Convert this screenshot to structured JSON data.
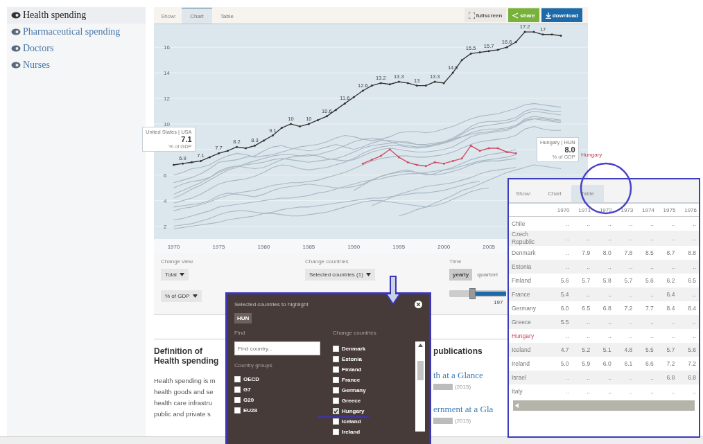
{
  "sidebar": {
    "items": [
      {
        "label": "Health spending",
        "selected": true
      },
      {
        "label": "Pharmaceutical spending",
        "selected": false
      },
      {
        "label": "Doctors",
        "selected": false
      },
      {
        "label": "Nurses",
        "selected": false
      }
    ]
  },
  "chart_panel": {
    "tabs_label": "Show:",
    "tabs": [
      {
        "label": "Chart",
        "selected": true
      },
      {
        "label": "Table",
        "selected": false
      }
    ],
    "buttons": [
      {
        "kind": "fullscreen",
        "label": "fullscreen"
      },
      {
        "kind": "share",
        "label": "share"
      },
      {
        "kind": "download",
        "label": "download"
      }
    ],
    "chart_data": {
      "type": "line",
      "xlim": [
        1967.8,
        2016
      ],
      "ylim": [
        1.0,
        17.8
      ],
      "grid": true,
      "x": [
        1970,
        1971,
        1972,
        1973,
        1974,
        1975,
        1976,
        1977,
        1978,
        1979,
        1980,
        1981,
        1982,
        1983,
        1984,
        1985,
        1986,
        1987,
        1988,
        1989,
        1990,
        1991,
        1992,
        1993,
        1994,
        1995,
        1996,
        1997,
        1998,
        1999,
        2000,
        2001,
        2002,
        2003,
        2004,
        2005,
        2006,
        2007,
        2008,
        2009,
        2010,
        2011,
        2012,
        2013
      ],
      "xticks": [
        1970,
        1975,
        1980,
        1985,
        1990,
        1995,
        2000,
        2005
      ],
      "yticks": [
        16,
        14,
        12,
        10,
        6,
        4,
        2
      ],
      "series": [
        {
          "color": "#333333",
          "values": [
            6.8,
            6.9,
            7.0,
            7.1,
            7.4,
            7.7,
            7.9,
            8.2,
            8.1,
            8.3,
            8.7,
            9.1,
            9.7,
            10,
            9.8,
            10,
            10.3,
            10.6,
            11.1,
            11.6,
            12.1,
            12.6,
            13.0,
            13.2,
            13.1,
            13.3,
            13.2,
            13.0,
            13.0,
            13.3,
            13.2,
            14.0,
            15.0,
            15.5,
            15.6,
            15.7,
            15.8,
            16.0,
            16.4,
            17.2,
            17.2,
            17.0,
            17.0,
            16.9
          ]
        },
        {
          "name": "Hungary",
          "color": "#d24c63",
          "values": [
            null,
            null,
            null,
            null,
            null,
            null,
            null,
            null,
            null,
            null,
            null,
            null,
            null,
            null,
            null,
            null,
            null,
            null,
            null,
            null,
            null,
            6.9,
            7.2,
            7.5,
            8.0,
            7.4,
            7.0,
            6.8,
            6.7,
            7.0,
            6.9,
            7.1,
            7.3,
            8.3,
            7.9,
            8.1,
            8.1,
            7.8,
            7.7,
            null,
            null,
            null,
            null,
            null
          ]
        },
        {
          "color": "#a9b7c2",
          "values": [
            3.2,
            3.4,
            3.5,
            3.7,
            3.9,
            4.2,
            4.4,
            4.6,
            4.7,
            4.8,
            5.0,
            5.2,
            5.3,
            5.4,
            5.4,
            5.5,
            5.6,
            5.8,
            6.0,
            6.2,
            6.5,
            6.8,
            7.1,
            7.3,
            7.4,
            7.5,
            7.5,
            7.4,
            7.4,
            7.5,
            7.6,
            7.8,
            8.1,
            8.4,
            8.6,
            8.7,
            8.8,
            8.9,
            9.1,
            9.6,
            9.8,
            9.6,
            9.5,
            9.5
          ]
        },
        {
          "color": "#a9b7c2",
          "values": [
            4.5,
            4.8,
            5.1,
            5.4,
            5.8,
            6.3,
            6.6,
            6.7,
            6.8,
            6.9,
            7.0,
            7.2,
            7.3,
            7.2,
            7.1,
            7.0,
            7.1,
            7.2,
            7.3,
            7.5,
            7.8,
            8.1,
            8.3,
            8.4,
            8.5,
            8.6,
            8.6,
            8.4,
            8.3,
            8.4,
            8.5,
            8.8,
            9.2,
            9.6,
            9.8,
            9.9,
            10.0,
            10.1,
            10.3,
            10.8,
            11.0,
            10.9,
            10.8,
            10.7
          ]
        },
        {
          "color": "#a9b7c2",
          "values": [
            5.0,
            5.3,
            5.5,
            5.6,
            5.8,
            6.2,
            6.5,
            6.7,
            6.6,
            6.5,
            6.6,
            6.9,
            7.2,
            7.4,
            7.5,
            7.6,
            7.5,
            7.3,
            7.2,
            7.1,
            7.2,
            7.5,
            7.8,
            8.0,
            8.1,
            8.0,
            7.9,
            7.8,
            7.8,
            7.9,
            8.0,
            8.2,
            8.6,
            9.0,
            9.2,
            9.3,
            9.4,
            9.5,
            9.8,
            10.4,
            10.6,
            10.5,
            10.4,
            10.3
          ]
        },
        {
          "color": "#a9b7c2",
          "values": [
            2.5,
            2.6,
            2.8,
            3.0,
            3.2,
            3.5,
            3.6,
            3.7,
            3.8,
            3.9,
            4.0,
            4.1,
            4.2,
            4.2,
            4.3,
            4.4,
            4.6,
            4.7,
            4.9,
            5.1,
            5.3,
            5.5,
            5.6,
            5.7,
            5.9,
            6.0,
            6.1,
            6.1,
            6.2,
            6.3,
            6.4,
            6.5,
            6.7,
            6.9,
            7.1,
            7.2,
            7.3,
            7.4,
            7.6,
            null,
            null,
            null,
            null,
            null
          ]
        },
        {
          "color": "#a9b7c2",
          "values": [
            3.8,
            4.0,
            4.2,
            4.5,
            4.9,
            5.3,
            5.5,
            5.6,
            5.7,
            5.9,
            6.2,
            6.6,
            6.8,
            6.7,
            6.5,
            6.4,
            6.5,
            6.6,
            6.8,
            7.0,
            7.3,
            7.7,
            8.0,
            8.2,
            8.3,
            8.3,
            8.2,
            8.1,
            8.2,
            8.4,
            8.6,
            8.9,
            9.3,
            9.8,
            10.1,
            10.2,
            10.2,
            10.3,
            10.5,
            11.0,
            11.2,
            11.1,
            11.0,
            11.0
          ]
        },
        {
          "color": "#a9b7c2",
          "values": [
            5.4,
            5.6,
            5.8,
            6.1,
            6.5,
            7.0,
            7.1,
            7.2,
            7.4,
            7.5,
            7.9,
            8.2,
            8.3,
            8.1,
            8.0,
            7.9,
            8.0,
            8.2,
            8.4,
            8.2,
            8.0,
            8.2,
            8.5,
            8.7,
            8.7,
            8.6,
            8.5,
            8.4,
            8.4,
            8.5,
            8.6,
            8.8,
            9.0,
            9.3,
            9.5,
            9.6,
            9.6,
            9.7,
            9.9,
            10.3,
            10.4,
            10.4,
            10.3,
            10.2
          ]
        },
        {
          "color": "#a9b7c2",
          "values": [
            1.8,
            1.9,
            2.0,
            2.1,
            2.2,
            2.3,
            2.5,
            2.6,
            2.7,
            2.8,
            3.0,
            3.1,
            3.3,
            3.4,
            3.5,
            3.5,
            3.6,
            3.7,
            3.8,
            3.9,
            4.0,
            4.1,
            4.2,
            4.2,
            4.3,
            4.4,
            4.5,
            4.6,
            4.6,
            4.7,
            4.8,
            5.0,
            5.2,
            5.4,
            5.5,
            null,
            null,
            null,
            null,
            null,
            null,
            null,
            null,
            null
          ]
        },
        {
          "color": "#a9b7c2",
          "values": [
            null,
            null,
            null,
            null,
            null,
            null,
            null,
            null,
            null,
            null,
            null,
            null,
            null,
            null,
            null,
            null,
            null,
            null,
            null,
            null,
            4.8,
            5.2,
            5.6,
            5.9,
            6.1,
            6.3,
            6.4,
            6.2,
            6.0,
            6.1,
            6.4,
            6.6,
            6.9,
            7.2,
            7.4,
            7.6,
            7.7,
            7.8,
            8.0,
            null,
            null,
            null,
            null,
            null
          ]
        },
        {
          "color": "#a9b7c2",
          "values": [
            null,
            null,
            null,
            null,
            null,
            null,
            null,
            null,
            null,
            null,
            null,
            null,
            null,
            null,
            null,
            null,
            null,
            null,
            null,
            null,
            null,
            null,
            null,
            null,
            null,
            2.8,
            3.0,
            3.3,
            3.5,
            3.8,
            4.1,
            4.4,
            4.8,
            5.0,
            5.3,
            5.6,
            5.9,
            6.2,
            6.4,
            6.6,
            6.8,
            6.7,
            6.6,
            6.5
          ]
        },
        {
          "color": "#a9b7c2",
          "values": [
            6.0,
            6.2,
            6.5,
            6.6,
            6.8,
            7.2,
            7.5,
            7.7,
            7.6,
            7.4,
            7.5,
            7.6,
            7.8,
            8.0,
            8.2,
            8.3,
            8.4,
            8.6,
            8.9,
            9.1,
            9.0,
            8.8,
            8.7,
            8.8,
            9.0,
            9.3,
            9.4,
            9.4,
            9.3,
            9.4,
            9.6,
            9.8,
            10.1,
            10.4,
            10.6,
            10.7,
            10.8,
            11.0,
            11.2,
            11.5,
            11.6,
            11.5,
            11.4,
            11.3
          ]
        },
        {
          "color": "#a9b7c2",
          "values": [
            3.5,
            3.6,
            3.7,
            3.8,
            4.0,
            4.4,
            4.6,
            4.5,
            4.4,
            4.3,
            4.5,
            4.8,
            5.0,
            5.1,
            5.2,
            5.3,
            5.2,
            5.1,
            5.0,
            5.0,
            5.1,
            5.3,
            5.6,
            5.9,
            6.1,
            6.2,
            6.3,
            6.2,
            6.1,
            6.0,
            6.1,
            6.3,
            6.5,
            6.8,
            7.0,
            7.1,
            7.1,
            7.2,
            7.3,
            null,
            null,
            null,
            null,
            null
          ]
        },
        {
          "color": "#a9b7c2",
          "values": [
            null,
            null,
            null,
            null,
            null,
            null,
            null,
            null,
            null,
            null,
            null,
            null,
            null,
            null,
            null,
            null,
            null,
            null,
            null,
            null,
            null,
            null,
            3.6,
            3.9,
            4.2,
            4.5,
            4.7,
            4.9,
            5.1,
            5.2,
            5.3,
            5.4,
            5.6,
            5.8,
            6.1,
            6.3,
            6.4,
            6.5,
            6.6,
            null,
            null,
            null,
            null,
            null
          ]
        },
        {
          "color": "#a9b7c2",
          "values": [
            2.0,
            2.1,
            2.2,
            2.4,
            2.6,
            2.9,
            3.1,
            3.2,
            3.2,
            3.1,
            3.0,
            3.0,
            2.9,
            2.8,
            2.8,
            2.9,
            3.0,
            3.1,
            3.3,
            3.5,
            3.7,
            3.9,
            4.0,
            4.0,
            3.9,
            3.8,
            3.7,
            3.6,
            3.5,
            3.6,
            3.8,
            4.1,
            4.4,
            4.7,
            4.9,
            5.0,
            null,
            null,
            null,
            null,
            null,
            null,
            null,
            null
          ]
        },
        {
          "color": "#a9b7c2",
          "values": [
            4.2,
            4.5,
            4.9,
            5.2,
            5.6,
            6.0,
            6.4,
            6.6,
            6.9,
            7.1,
            7.3,
            7.5,
            7.6,
            7.6,
            7.5,
            7.5,
            7.6,
            7.8,
            8.0,
            8.3,
            8.6,
            8.8,
            8.9,
            8.8,
            8.6,
            8.4,
            8.3,
            8.2,
            8.2,
            8.3,
            8.5,
            8.7,
            9.0,
            9.2,
            9.3,
            9.4,
            9.5,
            9.6,
            9.8,
            10.2,
            10.4,
            10.3,
            10.2,
            10.1
          ]
        }
      ],
      "value_labels": [
        "6.9",
        "7.1",
        "7.7",
        "8.2",
        "8.3",
        "9.1",
        "10",
        "10",
        "10.6",
        "11.6",
        "12.6",
        "13.2",
        "13.3",
        "13",
        "13.3",
        "14.6",
        "15.5",
        "15.7",
        "16.6",
        "17.2",
        "17"
      ]
    },
    "tooltips": [
      {
        "title": "United States | USA",
        "value": "7.1",
        "unit": "% of GDP"
      },
      {
        "title": "Hungary | HUN",
        "value": "8.0",
        "unit": "% of GDP"
      }
    ]
  },
  "controls": {
    "view_label": "Change view",
    "view_selects": [
      "Total",
      "% of GDP"
    ],
    "countries_label": "Change countries",
    "countries_select": "Selected countries (1)",
    "time_label": "Time",
    "frequencies": [
      {
        "label": "yearly",
        "selected": true
      },
      {
        "label": "quarterl",
        "selected": false
      }
    ],
    "time_slider": {
      "level": 0.4
    },
    "range_label": "197"
  },
  "definition": {
    "heading": "Definition of Health spending",
    "text": "Health spending is m\nhealth goods and se\nhealth care infrastru\npublic and private s"
  },
  "publications": {
    "heading": "publications",
    "links": [
      {
        "title": "th at a Glance",
        "year": "(2015)"
      },
      {
        "title": "ernment at a Gla",
        "year": "(2015)"
      }
    ]
  },
  "table_view": {
    "tabs_label": "Show:",
    "tabs": [
      {
        "label": "Chart",
        "selected": false
      },
      {
        "label": "Table",
        "selected": true
      }
    ],
    "columns": [
      "1970",
      "1971",
      "1972",
      "1973",
      "1974",
      "1975",
      "1976"
    ],
    "rows": [
      {
        "country": "Chile",
        "highlighted": false,
        "values": [
          "..",
          "..",
          "..",
          "..",
          "..",
          "..",
          ".."
        ]
      },
      {
        "country": "Czech Republic",
        "highlighted": false,
        "values": [
          "..",
          "..",
          "..",
          "..",
          "..",
          "..",
          ".."
        ]
      },
      {
        "country": "Denmark",
        "highlighted": false,
        "values": [
          "..",
          "7.9",
          "8.0",
          "7.8",
          "8.5",
          "8.7",
          "8.8"
        ]
      },
      {
        "country": "Estonia",
        "highlighted": false,
        "values": [
          "..",
          "..",
          "..",
          "..",
          "..",
          "..",
          ".."
        ]
      },
      {
        "country": "Finland",
        "highlighted": false,
        "values": [
          "5.6",
          "5.7",
          "5.8",
          "5.7",
          "5.6",
          "6.2",
          "6.5"
        ]
      },
      {
        "country": "France",
        "highlighted": false,
        "values": [
          "5.4",
          "..",
          "..",
          "..",
          "..",
          "6.4",
          ".."
        ]
      },
      {
        "country": "Germany",
        "highlighted": false,
        "values": [
          "6.0",
          "6.5",
          "6.8",
          "7.2",
          "7.7",
          "8.4",
          "8.4"
        ]
      },
      {
        "country": "Greece",
        "highlighted": false,
        "values": [
          "5.5",
          "..",
          "..",
          "..",
          "..",
          "..",
          ".."
        ]
      },
      {
        "country": "Hungary",
        "highlighted": true,
        "values": [
          "..",
          "..",
          "..",
          "..",
          "..",
          "..",
          ".."
        ]
      },
      {
        "country": "Iceland",
        "highlighted": false,
        "values": [
          "4.7",
          "5.2",
          "5.1",
          "4.8",
          "5.5",
          "5.7",
          "5.6"
        ]
      },
      {
        "country": "Ireland",
        "highlighted": false,
        "values": [
          "5.0",
          "5.9",
          "6.0",
          "6.1",
          "6.6",
          "7.2",
          "7.2"
        ]
      },
      {
        "country": "Israel",
        "highlighted": false,
        "values": [
          "..",
          "..",
          "..",
          "..",
          "..",
          "6.8",
          "6.8"
        ]
      },
      {
        "country": "Italy",
        "highlighted": false,
        "values": [
          "..",
          "..",
          "..",
          "..",
          "..",
          "..",
          ".."
        ]
      }
    ]
  },
  "country_popup": {
    "title": "Selected countries to highlight",
    "chips": [
      "HUN"
    ],
    "find_label": "Find",
    "find_placeholder": "Find country...",
    "groups_label": "Country groups",
    "groups": [
      {
        "label": "OECD",
        "checked": false
      },
      {
        "label": "G7",
        "checked": false
      },
      {
        "label": "G20",
        "checked": false
      },
      {
        "label": "EU28",
        "checked": false
      }
    ],
    "countries_label": "Change countries",
    "countries": [
      {
        "label": "Denmark",
        "checked": false
      },
      {
        "label": "Estonia",
        "checked": false
      },
      {
        "label": "Finland",
        "checked": false
      },
      {
        "label": "France",
        "checked": false
      },
      {
        "label": "Germany",
        "checked": false
      },
      {
        "label": "Greece",
        "checked": false
      },
      {
        "label": "Hungary",
        "checked": true
      },
      {
        "label": "Iceland",
        "checked": false
      },
      {
        "label": "Ireland",
        "checked": false
      }
    ]
  }
}
